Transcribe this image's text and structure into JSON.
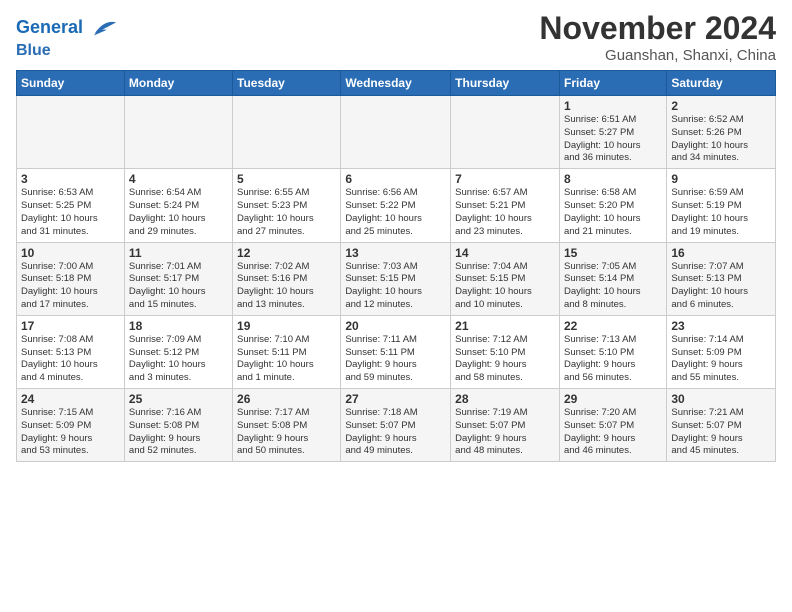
{
  "header": {
    "logo_line1": "General",
    "logo_line2": "Blue",
    "month": "November 2024",
    "location": "Guanshan, Shanxi, China"
  },
  "weekdays": [
    "Sunday",
    "Monday",
    "Tuesday",
    "Wednesday",
    "Thursday",
    "Friday",
    "Saturday"
  ],
  "weeks": [
    [
      {
        "day": "",
        "info": ""
      },
      {
        "day": "",
        "info": ""
      },
      {
        "day": "",
        "info": ""
      },
      {
        "day": "",
        "info": ""
      },
      {
        "day": "",
        "info": ""
      },
      {
        "day": "1",
        "info": "Sunrise: 6:51 AM\nSunset: 5:27 PM\nDaylight: 10 hours\nand 36 minutes."
      },
      {
        "day": "2",
        "info": "Sunrise: 6:52 AM\nSunset: 5:26 PM\nDaylight: 10 hours\nand 34 minutes."
      }
    ],
    [
      {
        "day": "3",
        "info": "Sunrise: 6:53 AM\nSunset: 5:25 PM\nDaylight: 10 hours\nand 31 minutes."
      },
      {
        "day": "4",
        "info": "Sunrise: 6:54 AM\nSunset: 5:24 PM\nDaylight: 10 hours\nand 29 minutes."
      },
      {
        "day": "5",
        "info": "Sunrise: 6:55 AM\nSunset: 5:23 PM\nDaylight: 10 hours\nand 27 minutes."
      },
      {
        "day": "6",
        "info": "Sunrise: 6:56 AM\nSunset: 5:22 PM\nDaylight: 10 hours\nand 25 minutes."
      },
      {
        "day": "7",
        "info": "Sunrise: 6:57 AM\nSunset: 5:21 PM\nDaylight: 10 hours\nand 23 minutes."
      },
      {
        "day": "8",
        "info": "Sunrise: 6:58 AM\nSunset: 5:20 PM\nDaylight: 10 hours\nand 21 minutes."
      },
      {
        "day": "9",
        "info": "Sunrise: 6:59 AM\nSunset: 5:19 PM\nDaylight: 10 hours\nand 19 minutes."
      }
    ],
    [
      {
        "day": "10",
        "info": "Sunrise: 7:00 AM\nSunset: 5:18 PM\nDaylight: 10 hours\nand 17 minutes."
      },
      {
        "day": "11",
        "info": "Sunrise: 7:01 AM\nSunset: 5:17 PM\nDaylight: 10 hours\nand 15 minutes."
      },
      {
        "day": "12",
        "info": "Sunrise: 7:02 AM\nSunset: 5:16 PM\nDaylight: 10 hours\nand 13 minutes."
      },
      {
        "day": "13",
        "info": "Sunrise: 7:03 AM\nSunset: 5:15 PM\nDaylight: 10 hours\nand 12 minutes."
      },
      {
        "day": "14",
        "info": "Sunrise: 7:04 AM\nSunset: 5:15 PM\nDaylight: 10 hours\nand 10 minutes."
      },
      {
        "day": "15",
        "info": "Sunrise: 7:05 AM\nSunset: 5:14 PM\nDaylight: 10 hours\nand 8 minutes."
      },
      {
        "day": "16",
        "info": "Sunrise: 7:07 AM\nSunset: 5:13 PM\nDaylight: 10 hours\nand 6 minutes."
      }
    ],
    [
      {
        "day": "17",
        "info": "Sunrise: 7:08 AM\nSunset: 5:13 PM\nDaylight: 10 hours\nand 4 minutes."
      },
      {
        "day": "18",
        "info": "Sunrise: 7:09 AM\nSunset: 5:12 PM\nDaylight: 10 hours\nand 3 minutes."
      },
      {
        "day": "19",
        "info": "Sunrise: 7:10 AM\nSunset: 5:11 PM\nDaylight: 10 hours\nand 1 minute."
      },
      {
        "day": "20",
        "info": "Sunrise: 7:11 AM\nSunset: 5:11 PM\nDaylight: 9 hours\nand 59 minutes."
      },
      {
        "day": "21",
        "info": "Sunrise: 7:12 AM\nSunset: 5:10 PM\nDaylight: 9 hours\nand 58 minutes."
      },
      {
        "day": "22",
        "info": "Sunrise: 7:13 AM\nSunset: 5:10 PM\nDaylight: 9 hours\nand 56 minutes."
      },
      {
        "day": "23",
        "info": "Sunrise: 7:14 AM\nSunset: 5:09 PM\nDaylight: 9 hours\nand 55 minutes."
      }
    ],
    [
      {
        "day": "24",
        "info": "Sunrise: 7:15 AM\nSunset: 5:09 PM\nDaylight: 9 hours\nand 53 minutes."
      },
      {
        "day": "25",
        "info": "Sunrise: 7:16 AM\nSunset: 5:08 PM\nDaylight: 9 hours\nand 52 minutes."
      },
      {
        "day": "26",
        "info": "Sunrise: 7:17 AM\nSunset: 5:08 PM\nDaylight: 9 hours\nand 50 minutes."
      },
      {
        "day": "27",
        "info": "Sunrise: 7:18 AM\nSunset: 5:07 PM\nDaylight: 9 hours\nand 49 minutes."
      },
      {
        "day": "28",
        "info": "Sunrise: 7:19 AM\nSunset: 5:07 PM\nDaylight: 9 hours\nand 48 minutes."
      },
      {
        "day": "29",
        "info": "Sunrise: 7:20 AM\nSunset: 5:07 PM\nDaylight: 9 hours\nand 46 minutes."
      },
      {
        "day": "30",
        "info": "Sunrise: 7:21 AM\nSunset: 5:07 PM\nDaylight: 9 hours\nand 45 minutes."
      }
    ]
  ]
}
